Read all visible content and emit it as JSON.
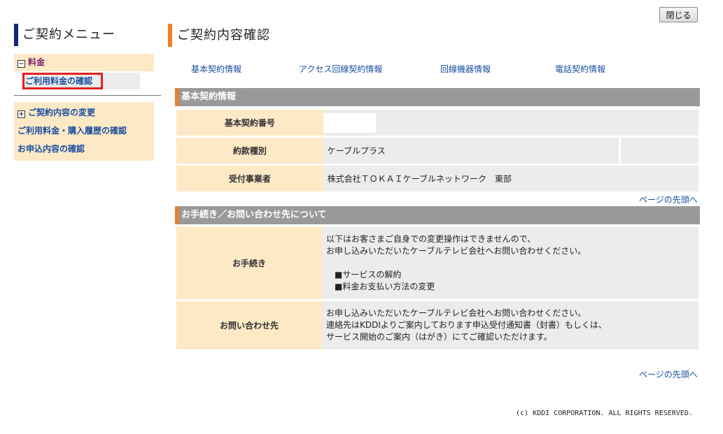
{
  "close_button": "閉じる",
  "sidebar": {
    "title": "ご契約メニュー",
    "group1": {
      "label": "料金",
      "toggle": "−",
      "selected_item": "ご利用料金の確認"
    },
    "group2": {
      "toggle": "+",
      "items": [
        "ご契約内容の変更",
        "ご利用料金・購入履歴の確認",
        "お申込内容の確認"
      ]
    }
  },
  "main": {
    "title": "ご契約内容確認",
    "nav": [
      "基本契約情報",
      "アクセス回線契約情報",
      "回線機器情報",
      "電話契約情報"
    ],
    "section1": {
      "header": "基本契約情報",
      "rows": [
        {
          "label": "基本契約番号",
          "value": ""
        },
        {
          "label": "約款種別",
          "value": "ケーブルプラス"
        },
        {
          "label": "受付事業者",
          "value": "株式会社ＴＯＫＡＩケーブルネットワーク　東部"
        }
      ]
    },
    "page_top_link": "ページの先頭へ",
    "section2": {
      "header": "お手続き／お問い合わせ先について",
      "procedure": {
        "label": "お手続き",
        "line1": "以下はお客さまご自身での変更操作はできませんので、",
        "line2": "お申し込みいただいたケーブルテレビ会社へお問い合わせください。",
        "bullet1": "■サービスの解約",
        "bullet2": "■料金お支払い方法の変更"
      },
      "contact": {
        "label": "お問い合わせ先",
        "line1": "お申し込みいただいたケーブルテレビ会社へお問い合わせください。",
        "line2": "連絡先はKDDIよりご案内しております申込受付通知書（封書）もしくは、",
        "line3": "サービス開始のご案内（はがき）にてご確認いただけます。"
      }
    }
  },
  "copyright": "(c) KDDI CORPORATION. ALL RIGHTS RESERVED.",
  "colors": {
    "accent_orange": "#f07d22",
    "accent_navy": "#1a237e",
    "link_blue": "#1a4fa0",
    "label_bg": "#fde9c6",
    "selected_border": "#e52020"
  }
}
